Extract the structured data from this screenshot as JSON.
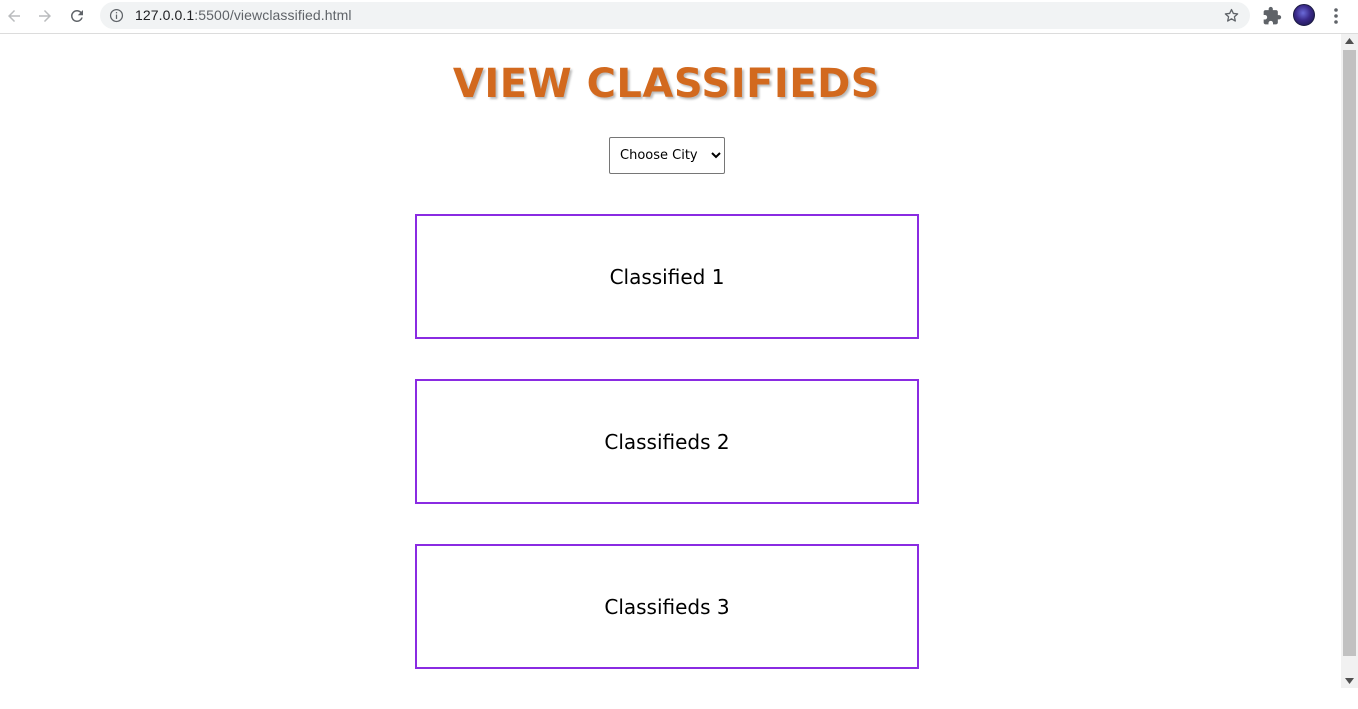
{
  "browser": {
    "url_host": "127.0.0.1",
    "url_rest": ":5500/viewclassified.html"
  },
  "page": {
    "title": "VIEW CLASSIFIEDS",
    "city_select": {
      "selected": "Choose City",
      "options": [
        "Choose City"
      ]
    },
    "classifieds": [
      {
        "title": "Classified 1"
      },
      {
        "title": "Classifieds 2"
      },
      {
        "title": "Classifieds 3"
      }
    ]
  },
  "colors": {
    "title": "#d2691e",
    "card_border": "#8a2be2"
  }
}
